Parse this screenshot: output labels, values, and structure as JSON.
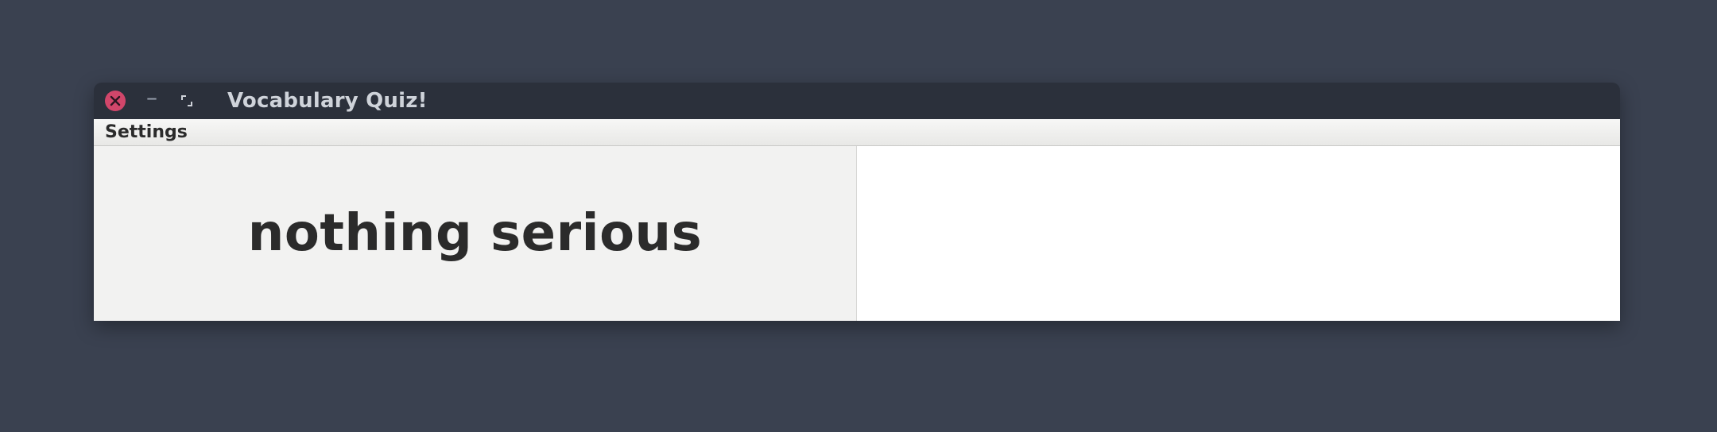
{
  "window": {
    "title": "Vocabulary Quiz!"
  },
  "menubar": {
    "settings_label": "Settings"
  },
  "quiz": {
    "prompt_text": "nothing serious",
    "answer_value": "",
    "answer_placeholder": ""
  }
}
